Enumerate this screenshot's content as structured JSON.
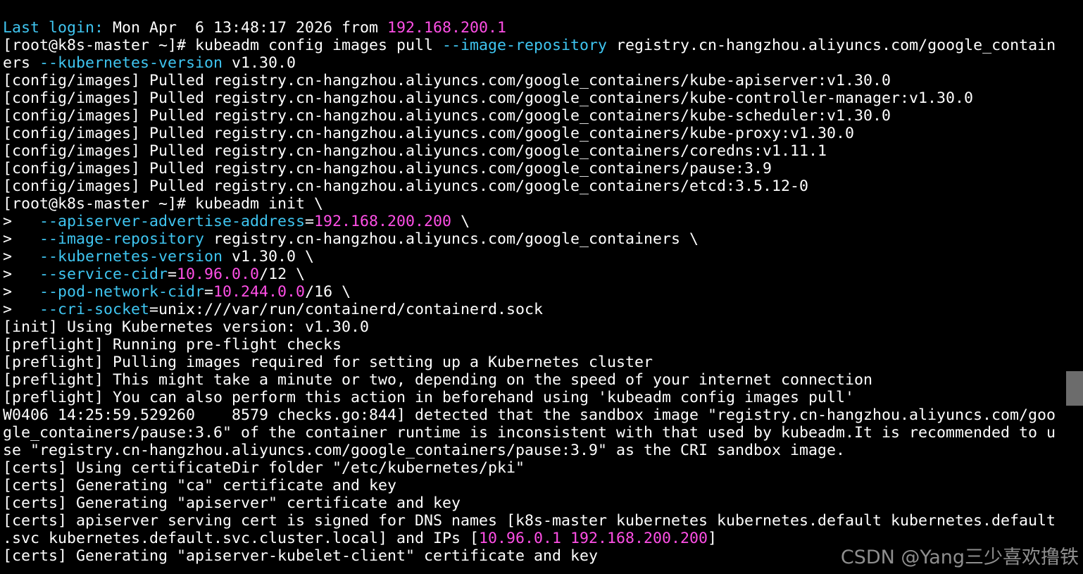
{
  "colors": {
    "background": "#000000",
    "text": "#ffffff",
    "cyan": "#3fc5f0",
    "magenta": "#ff4fe6",
    "scroll_thumb": "#6c6c6c",
    "watermark": "#9e9e9e"
  },
  "watermark": "CSDN @Yang三少喜欢撸铁",
  "lines": [
    [
      {
        "t": "Last login: ",
        "c": "c"
      },
      {
        "t": "Mon Apr  6 13:48:17 2026 from ",
        "c": "w"
      },
      {
        "t": "192.168.200.1",
        "c": "m"
      }
    ],
    [
      {
        "t": "[root@k8s-master ~]# kubeadm config images pull ",
        "c": "w"
      },
      {
        "t": "--image-repository",
        "c": "c"
      },
      {
        "t": " registry.cn-hangzhou.aliyuncs.com/google_contain",
        "c": "w"
      }
    ],
    [
      {
        "t": "ers ",
        "c": "w"
      },
      {
        "t": "--kubernetes-version",
        "c": "c"
      },
      {
        "t": " v1.30.0",
        "c": "w"
      }
    ],
    [
      {
        "t": "[config/images] Pulled registry.cn-hangzhou.aliyuncs.com/google_containers/kube-apiserver:v1.30.0",
        "c": "w"
      }
    ],
    [
      {
        "t": "[config/images] Pulled registry.cn-hangzhou.aliyuncs.com/google_containers/kube-controller-manager:v1.30.0",
        "c": "w"
      }
    ],
    [
      {
        "t": "[config/images] Pulled registry.cn-hangzhou.aliyuncs.com/google_containers/kube-scheduler:v1.30.0",
        "c": "w"
      }
    ],
    [
      {
        "t": "[config/images] Pulled registry.cn-hangzhou.aliyuncs.com/google_containers/kube-proxy:v1.30.0",
        "c": "w"
      }
    ],
    [
      {
        "t": "[config/images] Pulled registry.cn-hangzhou.aliyuncs.com/google_containers/coredns:v1.11.1",
        "c": "w"
      }
    ],
    [
      {
        "t": "[config/images] Pulled registry.cn-hangzhou.aliyuncs.com/google_containers/pause:3.9",
        "c": "w"
      }
    ],
    [
      {
        "t": "[config/images] Pulled registry.cn-hangzhou.aliyuncs.com/google_containers/etcd:3.5.12-0",
        "c": "w"
      }
    ],
    [
      {
        "t": "[root@k8s-master ~]# kubeadm init \\",
        "c": "w"
      }
    ],
    [
      {
        "t": ">   ",
        "c": "w"
      },
      {
        "t": "--apiserver-advertise-address",
        "c": "c"
      },
      {
        "t": "=",
        "c": "w"
      },
      {
        "t": "192.168.200.200",
        "c": "m"
      },
      {
        "t": " \\",
        "c": "w"
      }
    ],
    [
      {
        "t": ">   ",
        "c": "w"
      },
      {
        "t": "--image-repository",
        "c": "c"
      },
      {
        "t": " registry.cn-hangzhou.aliyuncs.com/google_containers \\",
        "c": "w"
      }
    ],
    [
      {
        "t": ">   ",
        "c": "w"
      },
      {
        "t": "--kubernetes-version",
        "c": "c"
      },
      {
        "t": " v1.30.0 \\",
        "c": "w"
      }
    ],
    [
      {
        "t": ">   ",
        "c": "w"
      },
      {
        "t": "--service-cidr",
        "c": "c"
      },
      {
        "t": "=",
        "c": "w"
      },
      {
        "t": "10.96.0.0",
        "c": "m"
      },
      {
        "t": "/12 \\",
        "c": "w"
      }
    ],
    [
      {
        "t": ">   ",
        "c": "w"
      },
      {
        "t": "--pod-network-cidr",
        "c": "c"
      },
      {
        "t": "=",
        "c": "w"
      },
      {
        "t": "10.244.0.0",
        "c": "m"
      },
      {
        "t": "/16 \\",
        "c": "w"
      }
    ],
    [
      {
        "t": ">   ",
        "c": "w"
      },
      {
        "t": "--cri-socket",
        "c": "c"
      },
      {
        "t": "=unix:///var/run/containerd/containerd.sock",
        "c": "w"
      }
    ],
    [
      {
        "t": "[init] Using Kubernetes version: v1.30.0",
        "c": "w"
      }
    ],
    [
      {
        "t": "[preflight] Running pre-flight checks",
        "c": "w"
      }
    ],
    [
      {
        "t": "[preflight] Pulling images required for setting up a Kubernetes cluster",
        "c": "w"
      }
    ],
    [
      {
        "t": "[preflight] This might take a minute or two, depending on the speed of your internet connection",
        "c": "w"
      }
    ],
    [
      {
        "t": "[preflight] You can also perform this action in beforehand using 'kubeadm config images pull'",
        "c": "w"
      }
    ],
    [
      {
        "t": "W0406 14:25:59.529260    8579 checks.go:844] detected that the sandbox image \"registry.cn-hangzhou.aliyuncs.com/goo",
        "c": "w"
      }
    ],
    [
      {
        "t": "gle_containers/pause:3.6\" of the container runtime is inconsistent with that used by kubeadm.It is recommended to u",
        "c": "w"
      }
    ],
    [
      {
        "t": "se \"registry.cn-hangzhou.aliyuncs.com/google_containers/pause:3.9\" as the CRI sandbox image.",
        "c": "w"
      }
    ],
    [
      {
        "t": "[certs] Using certificateDir folder \"/etc/kubernetes/pki\"",
        "c": "w"
      }
    ],
    [
      {
        "t": "[certs] Generating \"ca\" certificate and key",
        "c": "w"
      }
    ],
    [
      {
        "t": "[certs] Generating \"apiserver\" certificate and key",
        "c": "w"
      }
    ],
    [
      {
        "t": "[certs] apiserver serving cert is signed for DNS names [k8s-master kubernetes kubernetes.default kubernetes.default",
        "c": "w"
      }
    ],
    [
      {
        "t": ".svc kubernetes.default.svc.cluster.local] and IPs [",
        "c": "w"
      },
      {
        "t": "10.96.0.1 192.168.200.200",
        "c": "m"
      },
      {
        "t": "]",
        "c": "w"
      }
    ],
    [
      {
        "t": "[certs] Generating \"apiserver-kubelet-client\" certificate and key",
        "c": "w"
      }
    ]
  ]
}
